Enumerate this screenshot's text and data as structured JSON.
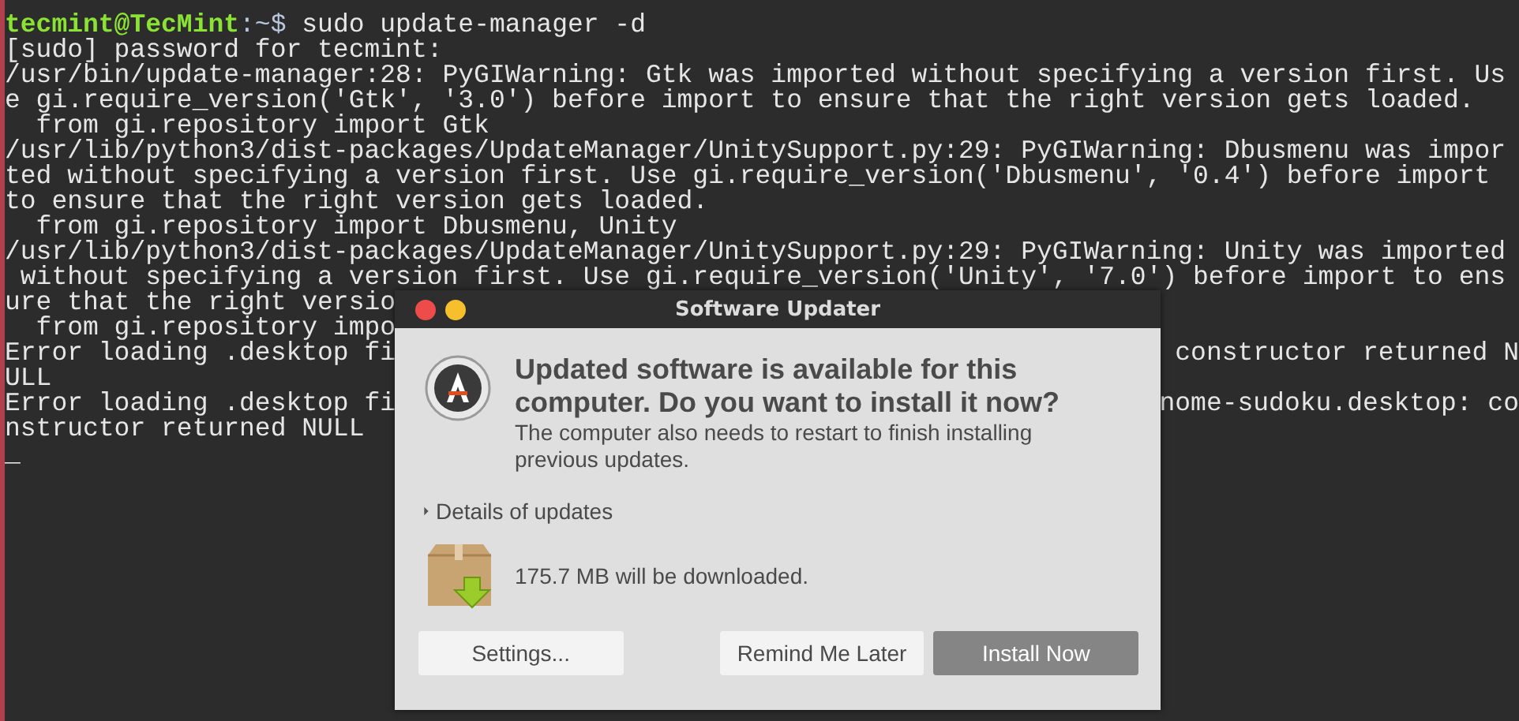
{
  "terminal": {
    "lines": [
      {
        "kind": "prompt",
        "user_host": "tecmint@TecMint",
        "prompt": ":~$",
        "command": " sudo update-manager -d"
      },
      {
        "kind": "output",
        "text": "[sudo] password for tecmint:"
      },
      {
        "kind": "output",
        "text": "/usr/bin/update-manager:28: PyGIWarning: Gtk was imported without specifying a version first. Us"
      },
      {
        "kind": "output",
        "text": "e gi.require_version('Gtk', '3.0') before import to ensure that the right version gets loaded."
      },
      {
        "kind": "output",
        "text": "  from gi.repository import Gtk"
      },
      {
        "kind": "output",
        "text": "/usr/lib/python3/dist-packages/UpdateManager/UnitySupport.py:29: PyGIWarning: Dbusmenu was impor"
      },
      {
        "kind": "output",
        "text": "ted without specifying a version first. Use gi.require_version('Dbusmenu', '0.4') before import"
      },
      {
        "kind": "output",
        "text": "to ensure that the right version gets loaded."
      },
      {
        "kind": "output",
        "text": "  from gi.repository import Dbusmenu, Unity"
      },
      {
        "kind": "output",
        "text": "/usr/lib/python3/dist-packages/UpdateManager/UnitySupport.py:29: PyGIWarning: Unity was imported"
      },
      {
        "kind": "output",
        "text": " without specifying a version first. Use gi.require_version('Unity', '7.0') before import to ens"
      },
      {
        "kind": "output",
        "text": "ure that the right versio"
      },
      {
        "kind": "output",
        "text": "  from gi.repository impo"
      },
      {
        "kind": "output",
        "text": "Error loading .desktop fi",
        "text_right": " constructor returned N"
      },
      {
        "kind": "output",
        "text": "ULL"
      },
      {
        "kind": "output",
        "text": "Error loading .desktop fi",
        "text_right": "nome-sudoku.desktop: co"
      },
      {
        "kind": "output",
        "text": "nstructor returned NULL"
      },
      {
        "kind": "cursor",
        "text": "_"
      }
    ]
  },
  "dialog": {
    "title": "Software Updater",
    "heading": "Updated software is available for this computer. Do you want to install it now?",
    "message": "The computer also needs to restart to finish installing previous updates.",
    "details": {
      "label": "Details of updates",
      "expanded": false
    },
    "download": "175.7 MB will be downloaded.",
    "buttons": [
      {
        "label": "Settings...",
        "kind": "normal"
      },
      {
        "label": "Remind Me Later",
        "kind": "normal"
      },
      {
        "label": "Install Now",
        "kind": "default"
      }
    ]
  }
}
